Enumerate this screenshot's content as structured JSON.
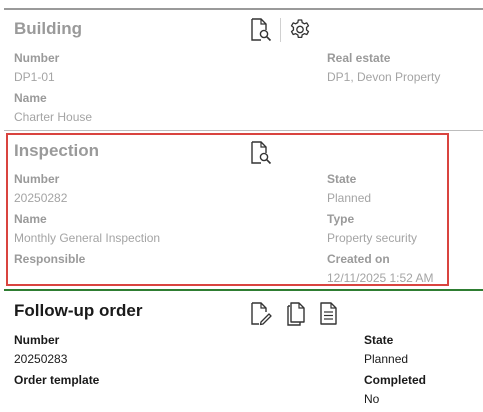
{
  "colors": {
    "building_line": "#9a9a9a",
    "inspection_line": "#bdbdbd",
    "followup_line": "#2e7d32",
    "highlight_border": "#d9443f",
    "muted_text": "#9a9a9a",
    "active_text": "#1a1a1a"
  },
  "building": {
    "title": "Building",
    "icons": [
      "preview-icon",
      "gear-icon"
    ],
    "number_label": "Number",
    "number_value": "DP1-01",
    "real_estate_label": "Real estate",
    "real_estate_value": "DP1, Devon Property",
    "name_label": "Name",
    "name_value": "Charter House"
  },
  "inspection": {
    "title": "Inspection",
    "icons": [
      "preview-icon"
    ],
    "number_label": "Number",
    "number_value": "20250282",
    "state_label": "State",
    "state_value": "Planned",
    "name_label": "Name",
    "name_value": "Monthly General Inspection",
    "type_label": "Type",
    "type_value": "Property security",
    "responsible_label": "Responsible",
    "created_label": "Created on",
    "created_value": "12/11/2025 1:52 AM"
  },
  "followup": {
    "title": "Follow-up order",
    "icons": [
      "edit-document-icon",
      "copy-icon",
      "document-icon"
    ],
    "number_label": "Number",
    "number_value": "20250283",
    "state_label": "State",
    "state_value": "Planned",
    "template_label": "Order template",
    "completed_label": "Completed",
    "completed_value": "No"
  }
}
